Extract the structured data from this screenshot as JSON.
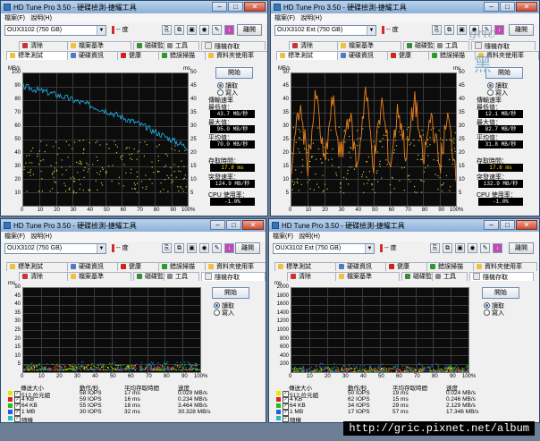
{
  "window_title": "HD Tune Pro 3.50 - 硬碟檢測-捷耀工具",
  "menu": [
    "檔案(F)",
    "說明(H)"
  ],
  "temp_text": "-- 度",
  "exit_label": "離開",
  "start_label": "開始",
  "radio_read": "讀取",
  "radio_write": "寫入",
  "watermark": "http://gric.pixnet.net/album",
  "stamp_text": "gric",
  "stamp_char": "黑",
  "colors": {
    "title_bar": "#a9c6e8",
    "chart_bg": "#0c0c0c",
    "cyan_series": "#1ea6d8",
    "orange_series": "#e8821e",
    "yellow_dots": "#c8c838"
  },
  "windows": [
    {
      "id": "tl",
      "drive": "OUX3102 (750 GB)",
      "tabs_row1": [
        "清除",
        "檔案基準",
        "磁碟監視",
        "工具",
        "隨機存取"
      ],
      "tabs_row2": [
        "標準測試",
        "硬碟資訊",
        "健康",
        "錯誤掃描",
        "資料夾使用率"
      ],
      "chart_units": {
        "left": "MB/s",
        "right": "ms"
      },
      "y_left": [
        "100",
        "90",
        "80",
        "70",
        "60",
        "50",
        "40",
        "30",
        "20",
        "10"
      ],
      "y_right": [
        "50",
        "45",
        "40",
        "35",
        "30",
        "25",
        "20",
        "15",
        "10",
        "5"
      ],
      "x_ticks": [
        "0",
        "10",
        "20",
        "30",
        "40",
        "50",
        "60",
        "70",
        "80",
        "90",
        "100%"
      ],
      "stats": {
        "transfer_label": "傳輸速率",
        "min_label": "最低值：",
        "min": "43.7 MB/秒",
        "max_label": "最大值：",
        "max": "95.0 MB/秒",
        "avg_label": "平均值：",
        "avg": "70.0 MB/秒",
        "access_label": "存取時間：",
        "access": "17.8 ms",
        "burst_label": "突發速率：",
        "burst": "124.9 MB/秒",
        "cpu_label": "CPU 使用率：",
        "cpu": "-1.0%"
      },
      "chart_data": {
        "type": "line",
        "title": "",
        "xlabel": "",
        "ylabel": "MB/s",
        "xlim": [
          0,
          100
        ],
        "ylim": [
          0,
          100
        ],
        "series": [
          {
            "x": [
              0,
              10,
              20,
              30,
              40,
              50,
              60,
              70,
              80,
              90,
              100
            ],
            "values": [
              90,
              87,
              84,
              80,
              76,
              72,
              67,
              62,
              56,
              50,
              44
            ]
          }
        ],
        "access_time_ms_range": [
          5,
          25
        ]
      }
    },
    {
      "id": "tr",
      "drive": "OUX3102 Ext (750 GB)",
      "tabs_row1": [
        "清除",
        "檔案基準",
        "磁碟監視",
        "工具",
        "隨機存取"
      ],
      "tabs_row2": [
        "標準測試",
        "硬碟資訊",
        "健康",
        "錯誤掃描",
        "資料夾使用率"
      ],
      "chart_units": {
        "left": "MB/s",
        "right": "ms"
      },
      "y_left": [
        "50",
        "45",
        "40",
        "35",
        "30",
        "25",
        "20",
        "15",
        "10",
        "5"
      ],
      "y_right": [
        "50",
        "45",
        "40",
        "35",
        "30",
        "25",
        "20",
        "15",
        "10",
        "5"
      ],
      "x_ticks": [
        "0",
        "10",
        "20",
        "30",
        "40",
        "50",
        "60",
        "70",
        "80",
        "90",
        "100%"
      ],
      "stats": {
        "transfer_label": "傳輸速率",
        "min_label": "最低值：",
        "min": "12.1 MB/秒",
        "max_label": "最大值：",
        "max": "82.7 MB/秒",
        "avg_label": "平均值：",
        "avg": "31.8 MB/秒",
        "access_label": "存取時間：",
        "access": "17.6 ms",
        "burst_label": "突發速率：",
        "burst": "132.9 MB/秒",
        "cpu_label": "CPU 使用率：",
        "cpu": "-1.0%"
      },
      "chart_data": {
        "type": "line",
        "title": "",
        "xlabel": "",
        "ylabel": "MB/s",
        "xlim": [
          0,
          100
        ],
        "ylim": [
          0,
          50
        ],
        "series": [
          {
            "x": [
              0,
              5,
              10,
              15,
              20,
              25,
              30,
              35,
              40,
              45,
              50,
              55,
              60,
              65,
              70,
              75,
              80,
              85,
              90,
              95,
              100
            ],
            "values": [
              14,
              38,
              16,
              42,
              15,
              40,
              17,
              36,
              14,
              44,
              16,
              39,
              15,
              37,
              18,
              41,
              16,
              35,
              15,
              33,
              14
            ]
          }
        ],
        "access_time_ms_range": [
          5,
          30
        ]
      }
    },
    {
      "id": "bl",
      "drive": "OUX3102 (750 GB)",
      "tabs_row1": [
        "標準測試",
        "硬碟資訊",
        "健康",
        "錯誤掃描",
        "資料夾使用率"
      ],
      "tabs_row2": [
        "清除",
        "檔案基準",
        "磁碟監視",
        "工具",
        "隨機存取"
      ],
      "chart_units": {
        "left": "ms"
      },
      "y_left": [
        "50",
        "45",
        "40",
        "35",
        "30",
        "25",
        "20",
        "15",
        "10",
        "5"
      ],
      "x_ticks": [
        "0",
        "10",
        "20",
        "30",
        "40",
        "50",
        "60",
        "70",
        "80",
        "90",
        "100%"
      ],
      "table_headers": [
        "傳送大小",
        "動作/秒",
        "平均存取時間",
        "速度"
      ],
      "rows": [
        {
          "color": "#e8e800",
          "size": "512 位元組",
          "ops": "58 IOPS",
          "avg": "17 ms",
          "speed": "0.029 MB/s"
        },
        {
          "color": "#e02020",
          "size": "4 KB",
          "ops": "59 IOPS",
          "avg": "16 ms",
          "speed": "0.234 MB/s"
        },
        {
          "color": "#20c020",
          "size": "64 KB",
          "ops": "55 IOPS",
          "avg": "18 ms",
          "speed": "3.464 MB/s"
        },
        {
          "color": "#2060e0",
          "size": "1 MB",
          "ops": "30 IOPS",
          "avg": "32 ms",
          "speed": "30.328 MB/s"
        },
        {
          "color": "#20c0c0",
          "size": "隨機",
          "ops": "",
          "avg": "",
          "speed": ""
        }
      ],
      "chart_data": {
        "type": "scatter",
        "title": "",
        "xlabel": "",
        "ylabel": "ms",
        "xlim": [
          0,
          100
        ],
        "ylim": [
          0,
          50
        ],
        "series": [
          {
            "name": "512 位元組",
            "y_range_ms": [
              1,
              4
            ]
          },
          {
            "name": "4 KB",
            "y_range_ms": [
              1,
              4
            ]
          },
          {
            "name": "64 KB",
            "y_range_ms": [
              1,
              5
            ]
          },
          {
            "name": "1 MB",
            "y_range_ms": [
              1,
              6
            ]
          }
        ]
      }
    },
    {
      "id": "br",
      "drive": "OUX3102 Ext (750 GB)",
      "tabs_row1": [
        "標準測試",
        "硬碟資訊",
        "健康",
        "錯誤掃描",
        "資料夾使用率"
      ],
      "tabs_row2": [
        "清除",
        "檔案基準",
        "磁碟監視",
        "工具",
        "隨機存取"
      ],
      "chart_units": {
        "left": "ms"
      },
      "y_left": [
        "2000",
        "1800",
        "1600",
        "1400",
        "1200",
        "1000",
        "800",
        "600",
        "400",
        "200"
      ],
      "x_ticks": [
        "0",
        "10",
        "20",
        "30",
        "40",
        "50",
        "60",
        "70",
        "80",
        "90",
        "100%"
      ],
      "table_headers": [
        "傳送大小",
        "動作/秒",
        "平均存取時間",
        "速度"
      ],
      "rows": [
        {
          "color": "#e8e800",
          "size": "512 位元組",
          "ops": "50 IOPS",
          "avg": "19 ms",
          "speed": "0.024 MB/s"
        },
        {
          "color": "#e02020",
          "size": "4 KB",
          "ops": "62 IOPS",
          "avg": "15 ms",
          "speed": "0.246 MB/s"
        },
        {
          "color": "#20c020",
          "size": "64 KB",
          "ops": "34 IOPS",
          "avg": "29 ms",
          "speed": "2.129 MB/s"
        },
        {
          "color": "#2060e0",
          "size": "1 MB",
          "ops": "17 IOPS",
          "avg": "57 ms",
          "speed": "17.346 MB/s"
        },
        {
          "color": "#20c0c0",
          "size": "隨機",
          "ops": "",
          "avg": "",
          "speed": ""
        }
      ],
      "chart_data": {
        "type": "scatter",
        "title": "",
        "xlabel": "",
        "ylabel": "ms",
        "xlim": [
          0,
          100
        ],
        "ylim": [
          0,
          2000
        ],
        "series": [
          {
            "name": "512 位元組",
            "y_range_ms": [
              0,
              100
            ]
          },
          {
            "name": "4 KB",
            "y_range_ms": [
              0,
              100
            ]
          },
          {
            "name": "64 KB",
            "y_range_ms": [
              0,
              150
            ]
          },
          {
            "name": "1 MB",
            "y_range_ms": [
              0,
              200
            ]
          }
        ]
      }
    }
  ]
}
